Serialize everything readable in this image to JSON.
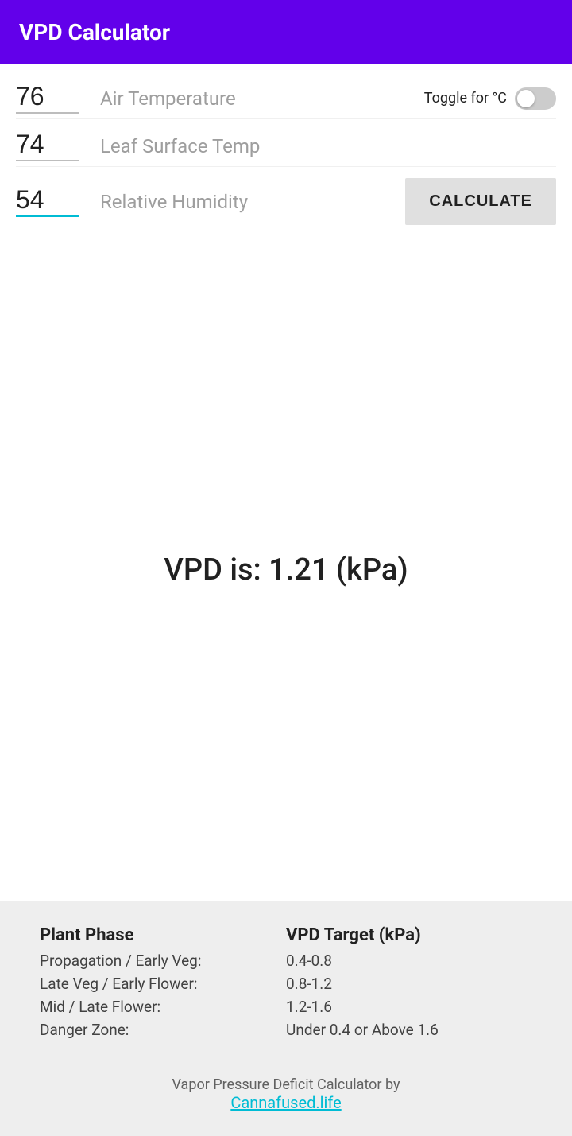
{
  "header": {
    "title": "VPD Calculator"
  },
  "inputs": {
    "air_temp": {
      "label": "Air Temperature",
      "value": "76",
      "id": "air-temp-input"
    },
    "leaf_temp": {
      "label": "Leaf Surface Temp",
      "value": "74",
      "id": "leaf-temp-input"
    },
    "humidity": {
      "label": "Relative Humidity",
      "value": "54",
      "id": "humidity-input"
    }
  },
  "toggle": {
    "label": "Toggle for °C"
  },
  "calculate_button": {
    "label": "CALCULATE"
  },
  "result": {
    "text": "VPD is: 1.21 (kPa)"
  },
  "reference": {
    "column_phase": "Plant Phase",
    "column_target": "VPD Target (kPa)",
    "rows": [
      {
        "phase": "Propagation / Early Veg:",
        "target": "0.4-0.8"
      },
      {
        "phase": "Late Veg / Early Flower:",
        "target": "0.8-1.2"
      },
      {
        "phase": "Mid / Late Flower:",
        "target": "1.2-1.6"
      },
      {
        "phase": "Danger Zone:",
        "target": "Under 0.4 or Above 1.6"
      }
    ]
  },
  "footer": {
    "by_text": "Vapor Pressure Deficit Calculator by",
    "link_text": "Cannafused.life"
  }
}
